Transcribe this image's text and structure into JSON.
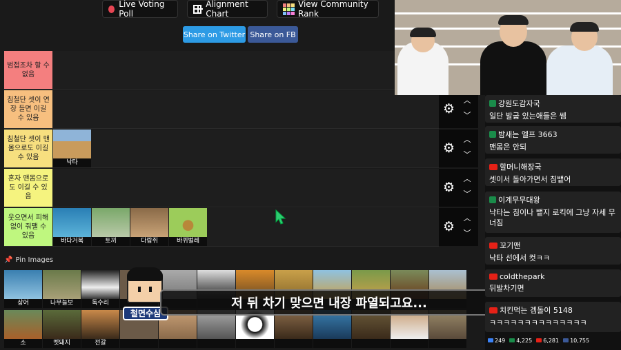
{
  "toolbar": {
    "live_voting_label": "Live Voting Poll",
    "alignment_label": "Alignment Chart",
    "community_rank_label": "View Community Rank",
    "share_twitter_label": "Share on Twitter",
    "share_fb_label": "Share on FB"
  },
  "colors": {
    "twitter": "#2d9be5",
    "facebook": "#3b5998",
    "tier_red": "#f47f7f",
    "tier_orange": "#f7bf7f",
    "tier_yellow": "#f7df7f",
    "tier_lightyellow": "#f5f37f",
    "tier_green": "#bff77f"
  },
  "tiers": [
    {
      "label": "범접조차 할 수 없음",
      "items": []
    },
    {
      "label": "침철단 셋이 연장 들면 이길 수 있음",
      "items": []
    },
    {
      "label": "침철단 셋이 맨몸으로도 이길 수 있음",
      "items": [
        "낙타"
      ]
    },
    {
      "label": "혼자 맨몸으로도 이길 수 있음",
      "items": []
    },
    {
      "label": "웃으면서 피해 없이 줘팰 수 있음",
      "items": [
        "바다거북",
        "토끼",
        "다람쥐",
        "바퀴벌레"
      ]
    }
  ],
  "pin_images": {
    "title": "Pin Images",
    "row1": [
      "상어",
      "나무늘보",
      "독수리",
      "",
      "",
      "",
      "",
      "",
      "",
      "",
      "",
      ""
    ],
    "row2": [
      "소",
      "멧돼지",
      "전갈",
      "",
      "",
      "",
      "",
      "",
      "",
      "",
      "",
      ""
    ]
  },
  "overlay": {
    "subtitle": "저 뒤 차기 맞으면 내장 파열되고요...",
    "name": "철면수심"
  },
  "chat": [
    {
      "user": "강원도감자국",
      "text": "일단 발굽 있는애들은 쎔"
    },
    {
      "user": "밤새는 엘프 3663",
      "text": "맨몸은 안되"
    },
    {
      "user": "할머니해장국",
      "text": "셋이서 돌아가면서 침뱉어"
    },
    {
      "user": "이계무무대왕",
      "text": "낙타는 침이나 뱉지 로킥에 그냥 자세 무너짐"
    },
    {
      "user": "꼬기맨",
      "text": "낙타 선에서 컷ㅋㅋ"
    },
    {
      "user": "coldthepark",
      "text": "뒤발차기면"
    },
    {
      "user": "치킨먹는 겜돌이 5148",
      "text": "ㅋㅋㅋㅋㅋㅋㅋㅋㅋㅋㅋㅋㅋㅋ"
    }
  ],
  "stats": [
    "249",
    "4,225",
    "6,281",
    "10,755"
  ]
}
